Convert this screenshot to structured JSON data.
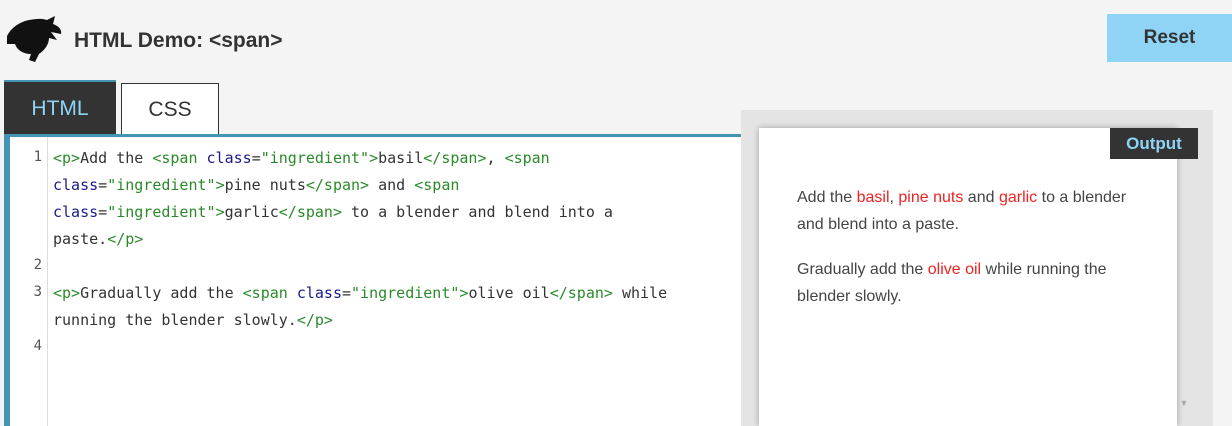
{
  "header": {
    "title": "HTML Demo: <span>",
    "reset_label": "Reset"
  },
  "tabs": [
    {
      "label": "HTML",
      "active": true
    },
    {
      "label": "CSS",
      "active": false
    }
  ],
  "editor": {
    "line_numbers": [
      "1",
      "2",
      "3",
      "4"
    ]
  },
  "output": {
    "label": "Output",
    "p1": {
      "a": "Add the ",
      "i1": "basil",
      "b": ", ",
      "i2": "pine nuts",
      "c": " and ",
      "i3": "garlic",
      "d": " to a blender and blend into a paste."
    },
    "p2": {
      "a": "Gradually add the ",
      "i1": "olive oil",
      "b": " while running the blender slowly."
    }
  },
  "colors": {
    "accent": "#8fd4f5",
    "tab_border": "#4494b4",
    "ingredient": "#ee2222",
    "tag": "#2a8a2a"
  }
}
